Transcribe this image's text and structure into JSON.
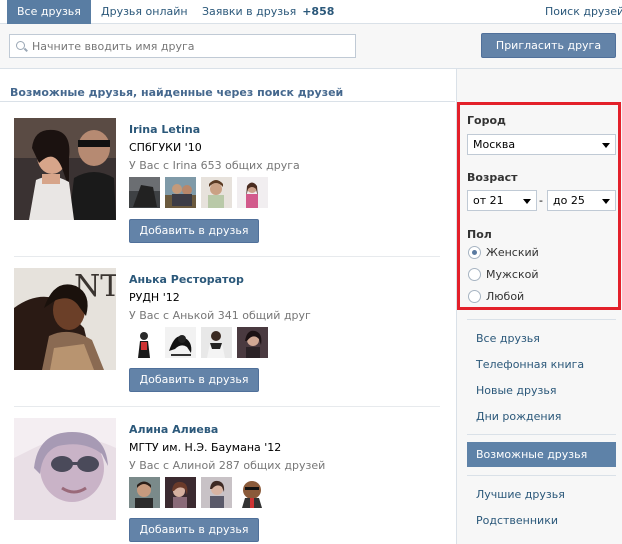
{
  "tabs": {
    "all": "Все друзья",
    "online": "Друзья онлайн",
    "requests": "Заявки в друзья",
    "requests_count": "+858",
    "search": "Поиск друзей"
  },
  "search": {
    "placeholder": "Начните вводить имя друга",
    "value": "",
    "invite_label": "Пригласить друга"
  },
  "section_title": "Возможные друзья, найденные через поиск друзей",
  "suggestions": [
    {
      "name": "Irina Letina",
      "school": "СПбГУКИ '10",
      "mutual": "У Вас с Irina 653 общих друга",
      "add_label": "Добавить в друзья"
    },
    {
      "name": "Анька Ресторатор",
      "school": "РУДН '12",
      "mutual": "У Вас с Анькой 341 общий друг",
      "add_label": "Добавить в друзья"
    },
    {
      "name": "Алина Алиева",
      "school": "МГТУ им. Н.Э. Баумана '12",
      "mutual": "У Вас с Алиной 287 общих друзей",
      "add_label": "Добавить в друзья"
    }
  ],
  "filters": {
    "city_label": "Город",
    "city_value": "Москва",
    "age_label": "Возраст",
    "age_from": "от 21",
    "age_dash": "-",
    "age_to": "до 25",
    "sex_label": "Пол",
    "sex_options": [
      "Женский",
      "Мужской",
      "Любой"
    ],
    "sex_selected": "Женский"
  },
  "menu": {
    "group1": [
      "Все друзья",
      "Телефонная книга",
      "Новые друзья",
      "Дни рождения"
    ],
    "active": "Возможные друзья",
    "group2": [
      "Лучшие друзья",
      "Родственники"
    ]
  },
  "colors": {
    "accent": "#597da3",
    "link": "#2b587a",
    "highlight_border": "#e3202a"
  }
}
